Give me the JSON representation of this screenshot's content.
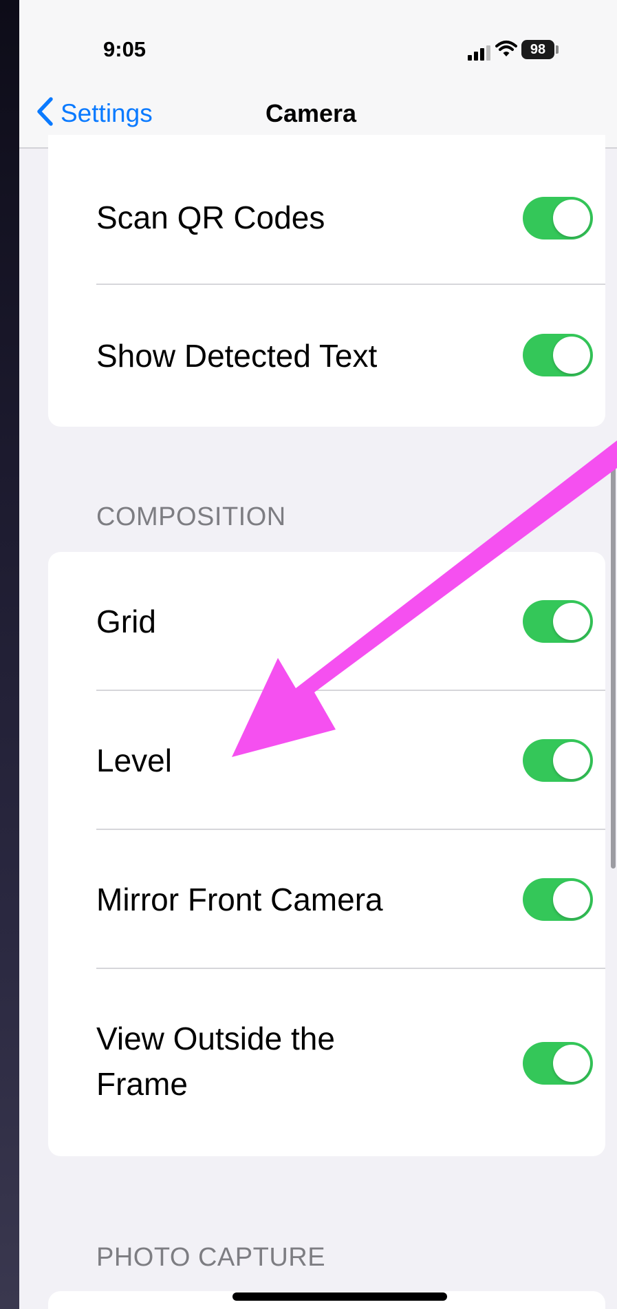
{
  "status_bar": {
    "time": "9:05",
    "battery": "98"
  },
  "nav": {
    "back_label": "Settings",
    "title": "Camera"
  },
  "group1": {
    "items": [
      {
        "label": "Scan QR Codes",
        "on": true
      },
      {
        "label": "Show Detected Text",
        "on": true
      }
    ]
  },
  "composition": {
    "header": "COMPOSITION",
    "items": [
      {
        "label": "Grid",
        "on": true
      },
      {
        "label": "Level",
        "on": true
      },
      {
        "label": "Mirror Front Camera",
        "on": true
      },
      {
        "label": "View Outside the Frame",
        "on": true
      }
    ]
  },
  "photo_capture": {
    "header": "PHOTO CAPTURE"
  },
  "colors": {
    "accent": "#0a7aff",
    "toggle_on": "#34c759",
    "annotation_arrow": "#f550f0",
    "background": "#f2f1f6"
  },
  "icons": [
    "chevron-left-icon",
    "cellular-signal-icon",
    "wifi-icon",
    "battery-icon",
    "annotation-arrow"
  ]
}
